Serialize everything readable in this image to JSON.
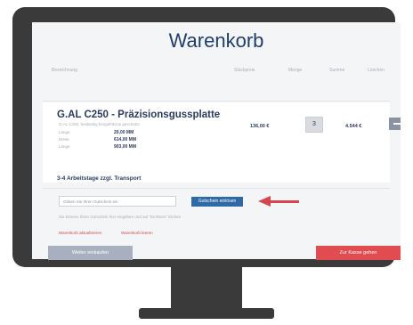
{
  "page": {
    "title": "Warenkorb",
    "header": {
      "col1": "Bezeichnung",
      "col2": "Stückpreis",
      "col3": "Menge",
      "col4": "Summe",
      "col5": "Löschen"
    },
    "item": {
      "title": "G.AL C250 - Präzisionsgussplatte",
      "meta": [
        {
          "label": "G.AL C250, beidseitig feingefräst & geschützt",
          "value": ""
        },
        {
          "label": "Länge",
          "value": "20,00 MM"
        },
        {
          "label": "Breite",
          "value": "614,00 MM"
        },
        {
          "label": "Länge",
          "value": "903,00 MM"
        }
      ],
      "delivery": "3-4 Arbeitstage zzgl. Transport",
      "unit_price": "136,00 €",
      "quantity": "3",
      "line_total": "4.544 €"
    },
    "voucher": {
      "placeholder": "Geben Sie Ihren Gutschein ein",
      "button": "Gutschein einlösen",
      "hint": "Sie können Ihren Gutschein hier eingeben und auf \"Einlösen\" klicken"
    },
    "links": {
      "refresh": "Warenkorb aktualisieren",
      "clear": "Warenkorb leeren"
    },
    "buttons": {
      "continue": "Weiter einkaufen",
      "checkout": "Zur Kasse gehen"
    }
  }
}
